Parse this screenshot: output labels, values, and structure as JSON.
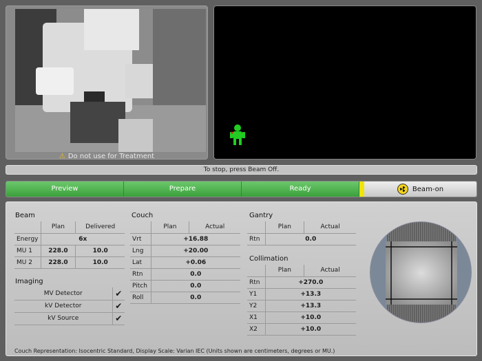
{
  "camera": {
    "warning": "Do not use for Treatment",
    "warning_icon": "warning-triangle-icon"
  },
  "stop_message": "To stop, press Beam Off.",
  "workflow": {
    "steps": [
      "Preview",
      "Prepare",
      "Ready"
    ],
    "beam_on_label": "Beam-on",
    "beam_icon": "radiation-icon",
    "colors": {
      "step": "#4caf4c",
      "indicator": "#f2e40a"
    }
  },
  "beam": {
    "title": "Beam",
    "headers": [
      "Plan",
      "Delivered"
    ],
    "energy": {
      "label": "Energy",
      "value": "6x"
    },
    "rows": [
      {
        "label": "MU 1",
        "plan": "228.0",
        "delivered": "10.0"
      },
      {
        "label": "MU 2",
        "plan": "228.0",
        "delivered": "10.0"
      }
    ]
  },
  "imaging": {
    "title": "Imaging",
    "rows": [
      {
        "label": "MV Detector",
        "checked": "✔"
      },
      {
        "label": "kV Detector",
        "checked": "✔"
      },
      {
        "label": "kV Source",
        "checked": "✔"
      }
    ]
  },
  "couch": {
    "title": "Couch",
    "headers": [
      "Plan",
      "Actual"
    ],
    "rows": [
      {
        "label": "Vrt",
        "value": "+16.88"
      },
      {
        "label": "Lng",
        "value": "+20.00"
      },
      {
        "label": "Lat",
        "value": "+0.06"
      },
      {
        "label": "Rtn",
        "value": "0.0"
      },
      {
        "label": "Pitch",
        "value": "0.0"
      },
      {
        "label": "Roll",
        "value": "0.0"
      }
    ]
  },
  "gantry": {
    "title": "Gantry",
    "headers": [
      "Plan",
      "Actual"
    ],
    "rows": [
      {
        "label": "Rtn",
        "value": "0.0"
      }
    ]
  },
  "collimation": {
    "title": "Collimation",
    "headers": [
      "Plan",
      "Actual"
    ],
    "rows": [
      {
        "label": "Rtn",
        "value": "+270.0"
      },
      {
        "label": "Y1",
        "value": "+13.3"
      },
      {
        "label": "Y2",
        "value": "+13.3"
      },
      {
        "label": "X1",
        "value": "+10.0"
      },
      {
        "label": "X2",
        "value": "+10.0"
      }
    ]
  },
  "footer": "Couch Representation: Isocentric Standard, Display Scale: Varian IEC (Units shown are centimeters, degrees or MU.)"
}
